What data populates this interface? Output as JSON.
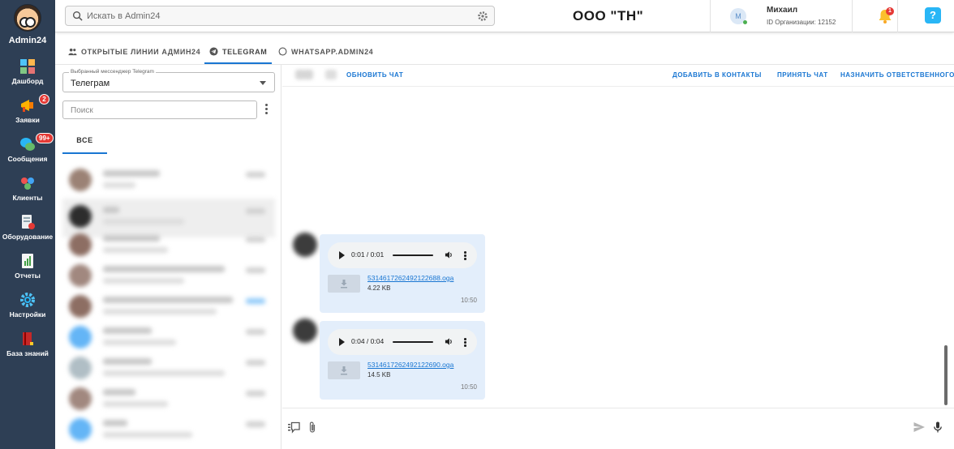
{
  "app": {
    "name": "Admin24"
  },
  "nav": {
    "items": [
      {
        "label": "Дашборд",
        "badge": ""
      },
      {
        "label": "Заявки",
        "badge": "2"
      },
      {
        "label": "Сообщения",
        "badge": "99+"
      },
      {
        "label": "Клиенты",
        "badge": ""
      },
      {
        "label": "Оборудование",
        "badge": ""
      },
      {
        "label": "Отчеты",
        "badge": ""
      },
      {
        "label": "Настройки",
        "badge": ""
      },
      {
        "label": "База знаний",
        "badge": ""
      }
    ]
  },
  "header": {
    "search_placeholder": "Искать в Admin24",
    "company": "ООО \"ТН\"",
    "user_initial": "М",
    "user_name": "Михаил",
    "org_id": "ID Организации: 12152",
    "notifications": "1",
    "help": "?"
  },
  "tabs": [
    {
      "label": "ОТКРЫТЫЕ ЛИНИИ АДМИН24"
    },
    {
      "label": "TELEGRAM"
    },
    {
      "label": "WHATSAPP.ADMIN24"
    }
  ],
  "left_panel": {
    "messenger_label": "Выбранный мессенджер Telegram",
    "messenger_value": "Телеграм",
    "search_placeholder": "Поиск",
    "subtab": "ВСЕ"
  },
  "chat_header": {
    "refresh": "ОБНОВИТЬ ЧАТ",
    "add_contacts": "ДОБАВИТЬ В КОНТАКТЫ",
    "accept": "ПРИНЯТЬ ЧАТ",
    "assign": "НАЗНАЧИТЬ ОТВЕТСТВЕННОГО"
  },
  "messages": [
    {
      "player_time": "0:01 / 0:01",
      "file": "5314617262492122688.oga",
      "size": "4.22 KB",
      "time": "10:50"
    },
    {
      "player_time": "0:04 / 0:04",
      "file": "5314617262492122690.oga",
      "size": "14.5 KB",
      "time": "10:50"
    }
  ],
  "colors": {
    "nav_bg": "#2e3f55",
    "accent": "#1976d2",
    "bubble": "#e3eefb"
  }
}
